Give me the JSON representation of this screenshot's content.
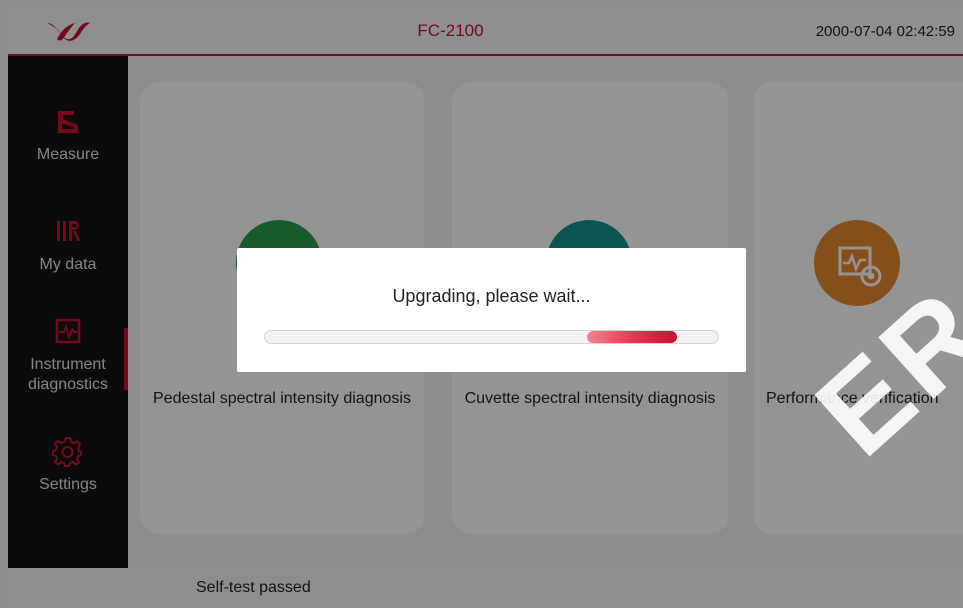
{
  "header": {
    "title": "FC-2100",
    "datetime": "2000-07-04 02:42:59"
  },
  "sidebar": {
    "items": [
      {
        "label": "Measure",
        "icon": "measure-icon"
      },
      {
        "label": "My data",
        "icon": "my-data-icon"
      },
      {
        "label": "Instrument\ndiagnostics",
        "icon": "diagnostics-icon",
        "active": true
      },
      {
        "label": "Settings",
        "icon": "gear-icon"
      }
    ]
  },
  "cards": [
    {
      "label": "Pedestal spectral intensity diagnosis",
      "color": "#2e9d4a"
    },
    {
      "label": "Cuvette spectral intensity diagnosis",
      "color": "#16908f"
    },
    {
      "label": "Performance verification",
      "color": "#e3892f"
    }
  ],
  "status": {
    "text": "Self-test passed"
  },
  "modal": {
    "message": "Upgrading, please wait...",
    "progress_start": 0.71,
    "progress_end": 0.91
  },
  "watermark": {
    "text": "ER"
  },
  "colors": {
    "brand": "#c8102e",
    "sidebar_bg": "#141414"
  }
}
